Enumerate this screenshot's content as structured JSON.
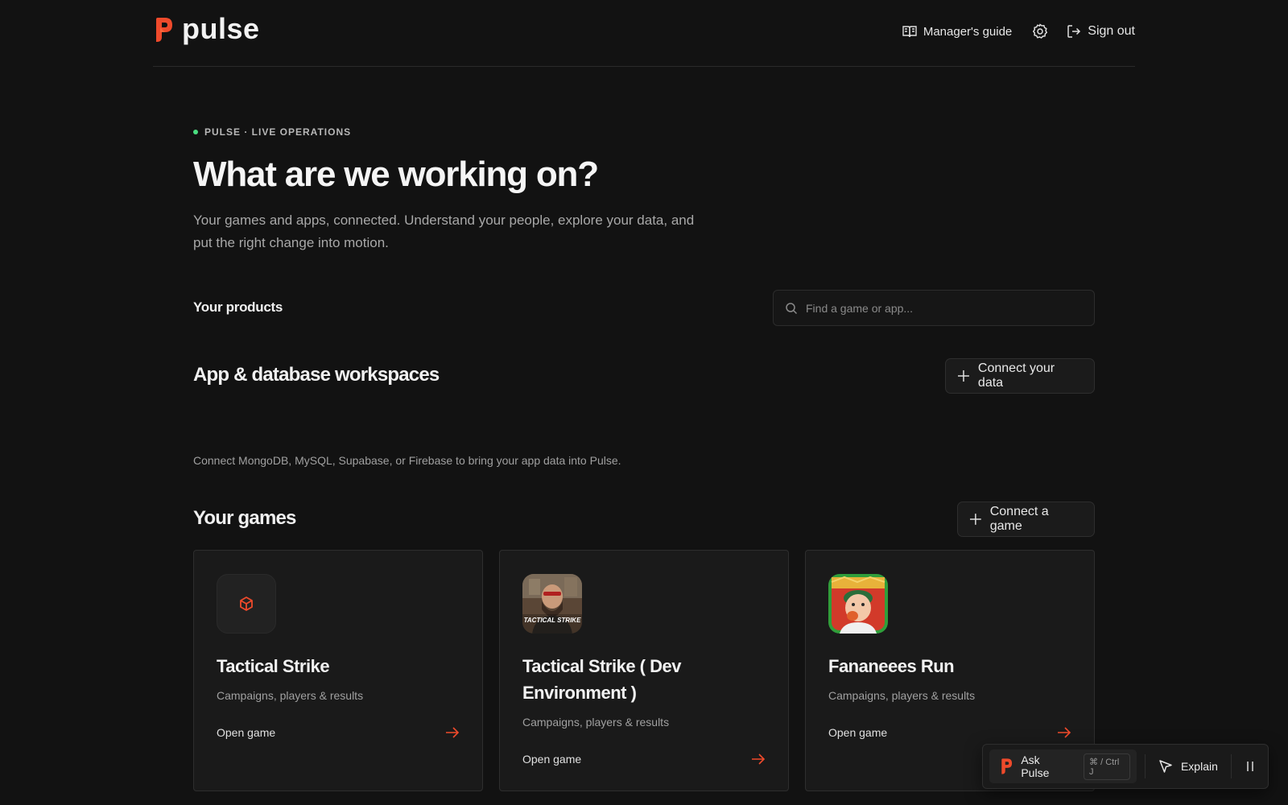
{
  "brand": {
    "name": "pulse",
    "accent_color": "#ef4a2b"
  },
  "header": {
    "guide_label": "Manager's guide",
    "guide_icon": "book-open-icon",
    "settings_icon": "gear-icon",
    "signout_label": "Sign out",
    "signout_icon": "log-out-icon"
  },
  "hero": {
    "eyebrow": "PULSE · LIVE OPERATIONS",
    "status_color": "#4ade80",
    "title": "What are we working on?",
    "subtitle": "Your games and apps, connected. Understand your people, explore your data, and put the right change into motion."
  },
  "products": {
    "label": "Your products",
    "search_placeholder": "Find a game or app..."
  },
  "workspaces": {
    "title": "App & database workspaces",
    "connect_label": "Connect your data",
    "hint": "Connect MongoDB, MySQL, Supabase, or Firebase to bring your app data into Pulse."
  },
  "games": {
    "title": "Your games",
    "connect_label": "Connect a game",
    "items": [
      {
        "title": "Tactical Strike",
        "subtitle": "Campaigns, players & results",
        "open_label": "Open game",
        "icon": "cube-icon"
      },
      {
        "title": "Tactical Strike ( Dev Environment )",
        "subtitle": "Campaigns, players & results",
        "open_label": "Open game",
        "icon": "tactical-strike-thumbnail",
        "thumb_text": "TACTICAL STRIKE"
      },
      {
        "title": "Fananeees Run",
        "subtitle": "Campaigns, players & results",
        "open_label": "Open game",
        "icon": "fananeees-run-thumbnail"
      }
    ]
  },
  "assistant_bar": {
    "ask_label": "Ask Pulse",
    "shortcut": "⌘ / Ctrl J",
    "explain_label": "Explain",
    "explain_icon": "cursor-arrow-icon",
    "pause_icon": "pause-icon"
  }
}
